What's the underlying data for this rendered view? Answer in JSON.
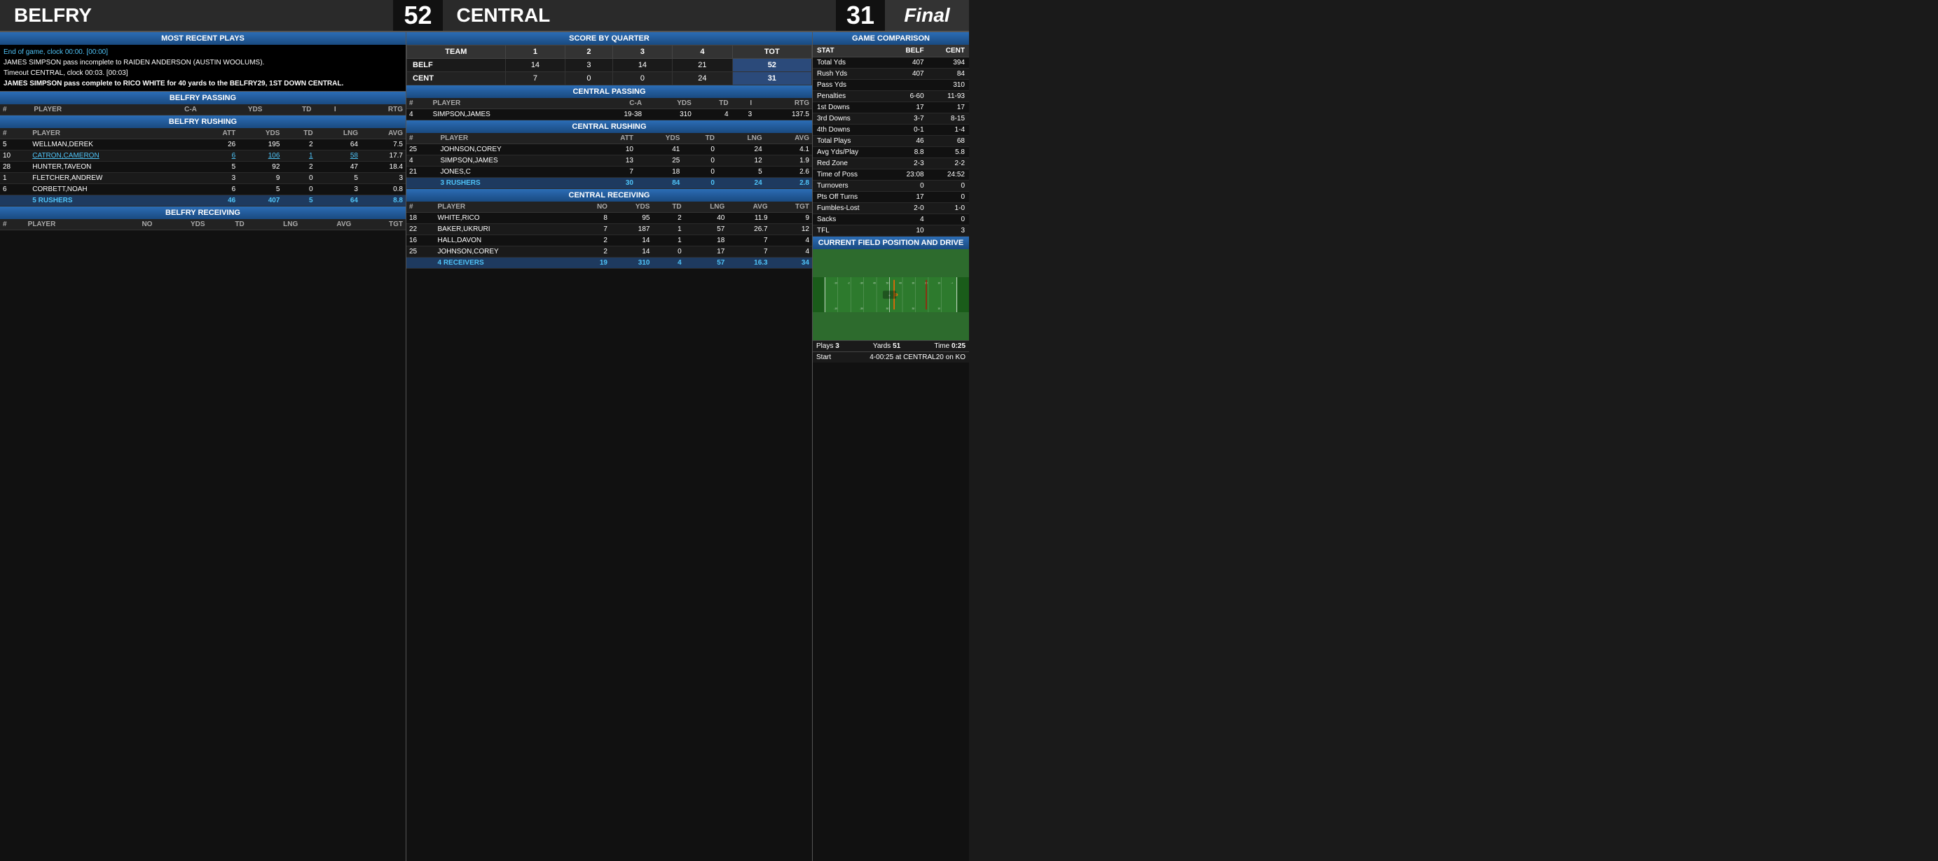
{
  "header": {
    "team_left": "BELFRY",
    "score_left": "52",
    "team_right": "CENTRAL",
    "score_right": "31",
    "status": "Final"
  },
  "plays": {
    "title": "MOST RECENT PLAYS",
    "lines": [
      {
        "text": "End of game, clock 00:00. [00:00]",
        "highlight": true
      },
      {
        "text": "JAMES SIMPSON pass incomplete to RAIDEN ANDERSON (AUSTIN WOOLUMS).",
        "highlight": false
      },
      {
        "text": "Timeout CENTRAL, clock 00:03. [00:03]",
        "highlight": false
      },
      {
        "text": "JAMES SIMPSON pass complete to RICO WHITE for 40 yards to the BELFRY29, 1ST DOWN CENTRAL.",
        "highlight": false,
        "bold": true
      }
    ]
  },
  "score_by_quarter": {
    "title": "SCORE BY QUARTER",
    "headers": [
      "TEAM",
      "1",
      "2",
      "3",
      "4",
      "TOT"
    ],
    "rows": [
      {
        "team": "BELF",
        "q1": "14",
        "q2": "3",
        "q3": "14",
        "q4": "21",
        "tot": "52"
      },
      {
        "team": "CENT",
        "q1": "7",
        "q2": "0",
        "q3": "0",
        "q4": "24",
        "tot": "31"
      }
    ]
  },
  "belfry_passing": {
    "title": "BELFRY PASSING",
    "headers": [
      "#",
      "PLAYER",
      "C-A",
      "YDS",
      "TD",
      "I",
      "RTG"
    ],
    "rows": []
  },
  "belfry_rushing": {
    "title": "BELFRY RUSHING",
    "headers": [
      "#",
      "PLAYER",
      "ATT",
      "YDS",
      "TD",
      "LNG",
      "AVG"
    ],
    "rows": [
      {
        "num": "5",
        "player": "WELLMAN,DEREK",
        "att": "26",
        "yds": "195",
        "td": "2",
        "lng": "64",
        "avg": "7.5"
      },
      {
        "num": "10",
        "player": "CATRON,CAMERON",
        "att": "6",
        "yds": "106",
        "td": "1",
        "lng": "58",
        "avg": "17.7",
        "link": true
      },
      {
        "num": "28",
        "player": "HUNTER,TAVEON",
        "att": "5",
        "yds": "92",
        "td": "2",
        "lng": "47",
        "avg": "18.4"
      },
      {
        "num": "1",
        "player": "FLETCHER,ANDREW",
        "att": "3",
        "yds": "9",
        "td": "0",
        "lng": "5",
        "avg": "3"
      },
      {
        "num": "6",
        "player": "CORBETT,NOAH",
        "att": "6",
        "yds": "5",
        "td": "0",
        "lng": "3",
        "avg": "0.8"
      }
    ],
    "totals": {
      "label": "5 RUSHERS",
      "att": "46",
      "yds": "407",
      "td": "5",
      "lng": "64",
      "avg": "8.8"
    }
  },
  "belfry_receiving": {
    "title": "BELFRY RECEIVING",
    "headers": [
      "#",
      "PLAYER",
      "NO",
      "YDS",
      "TD",
      "LNG",
      "AVG",
      "TGT"
    ],
    "rows": []
  },
  "central_passing": {
    "title": "CENTRAL PASSING",
    "headers": [
      "#",
      "PLAYER",
      "C-A",
      "YDS",
      "TD",
      "I",
      "RTG"
    ],
    "rows": [
      {
        "num": "4",
        "player": "SIMPSON,JAMES",
        "ca": "19-38",
        "yds": "310",
        "td": "4",
        "i": "3",
        "rtg": "137.5"
      }
    ]
  },
  "central_rushing": {
    "title": "CENTRAL RUSHING",
    "headers": [
      "#",
      "PLAYER",
      "ATT",
      "YDS",
      "TD",
      "LNG",
      "AVG"
    ],
    "rows": [
      {
        "num": "25",
        "player": "JOHNSON,COREY",
        "att": "10",
        "yds": "41",
        "td": "0",
        "lng": "24",
        "avg": "4.1"
      },
      {
        "num": "4",
        "player": "SIMPSON,JAMES",
        "att": "13",
        "yds": "25",
        "td": "0",
        "lng": "12",
        "avg": "1.9"
      },
      {
        "num": "21",
        "player": "JONES,C",
        "att": "7",
        "yds": "18",
        "td": "0",
        "lng": "5",
        "avg": "2.6"
      }
    ],
    "totals": {
      "label": "3 RUSHERS",
      "att": "30",
      "yds": "84",
      "td": "0",
      "lng": "24",
      "avg": "2.8"
    }
  },
  "central_receiving": {
    "title": "CENTRAL RECEIVING",
    "headers": [
      "#",
      "PLAYER",
      "NO",
      "YDS",
      "TD",
      "LNG",
      "AVG",
      "TGT"
    ],
    "rows": [
      {
        "num": "18",
        "player": "WHITE,RICO",
        "no": "8",
        "yds": "95",
        "td": "2",
        "lng": "40",
        "avg": "11.9",
        "tgt": "9"
      },
      {
        "num": "22",
        "player": "BAKER,UKRURI",
        "no": "7",
        "yds": "187",
        "td": "1",
        "lng": "57",
        "avg": "26.7",
        "tgt": "12"
      },
      {
        "num": "16",
        "player": "HALL,DAVON",
        "no": "2",
        "yds": "14",
        "td": "1",
        "lng": "18",
        "avg": "7",
        "tgt": "4"
      },
      {
        "num": "25",
        "player": "JOHNSON,COREY",
        "no": "2",
        "yds": "14",
        "td": "0",
        "lng": "17",
        "avg": "7",
        "tgt": "4"
      }
    ],
    "totals": {
      "label": "4 RECEIVERS",
      "no": "19",
      "yds": "310",
      "td": "4",
      "lng": "57",
      "avg": "16.3",
      "tgt": "34"
    }
  },
  "game_comparison": {
    "title": "GAME COMPARISON",
    "headers": [
      "STAT",
      "BELF",
      "CENT"
    ],
    "rows": [
      {
        "stat": "Total Yds",
        "belf": "407",
        "cent": "394"
      },
      {
        "stat": "Rush Yds",
        "belf": "407",
        "cent": "84"
      },
      {
        "stat": "Pass Yds",
        "belf": "",
        "cent": "310"
      },
      {
        "stat": "Penalties",
        "belf": "6-60",
        "cent": "11-93"
      },
      {
        "stat": "1st Downs",
        "belf": "17",
        "cent": "17"
      },
      {
        "stat": "3rd Downs",
        "belf": "3-7",
        "cent": "8-15"
      },
      {
        "stat": "4th Downs",
        "belf": "0-1",
        "cent": "1-4"
      },
      {
        "stat": "Total Plays",
        "belf": "46",
        "cent": "68"
      },
      {
        "stat": "Avg Yds/Play",
        "belf": "8.8",
        "cent": "5.8"
      },
      {
        "stat": "Red Zone",
        "belf": "2-3",
        "cent": "2-2"
      },
      {
        "stat": "Time of Poss",
        "belf": "23:08",
        "cent": "24:52"
      },
      {
        "stat": "Turnovers",
        "belf": "0",
        "cent": "0"
      },
      {
        "stat": "Pts Off Turns",
        "belf": "17",
        "cent": "0"
      },
      {
        "stat": "Fumbles-Lost",
        "belf": "2-0",
        "cent": "1-0"
      },
      {
        "stat": "Sacks",
        "belf": "4",
        "cent": "0"
      },
      {
        "stat": "TFL",
        "belf": "10",
        "cent": "3"
      }
    ]
  },
  "field_position": {
    "title": "CURRENT FIELD POSITION AND DRIVE",
    "plays_label": "Plays",
    "plays_value": "3",
    "yards_label": "Yards",
    "yards_value": "51",
    "time_label": "Time",
    "time_value": "0:25",
    "start_label": "Start",
    "start_value": "4-00:25 at CENTRAL20 on KO"
  }
}
